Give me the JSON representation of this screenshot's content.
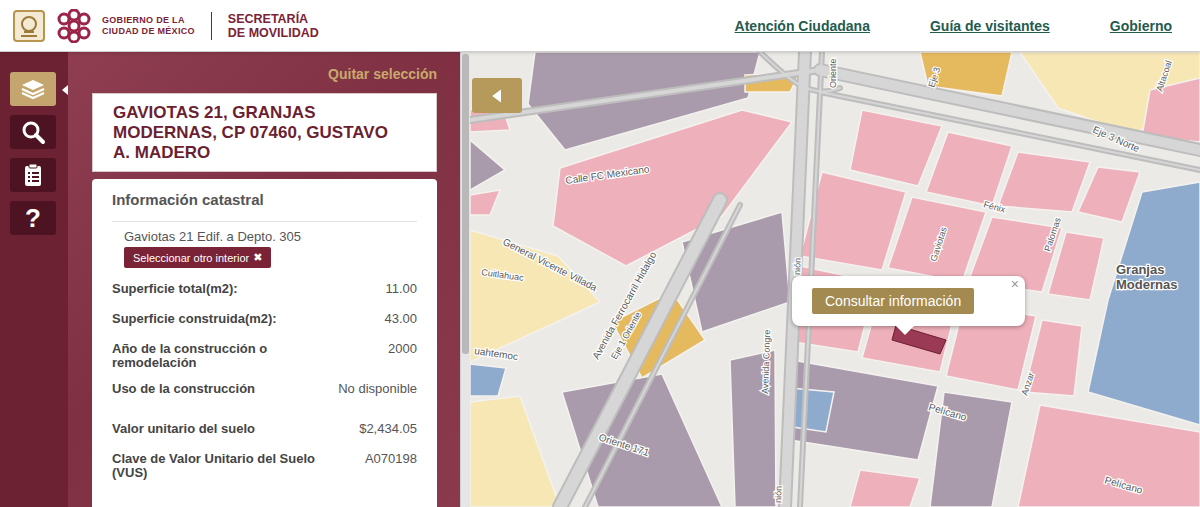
{
  "header": {
    "gob_line1": "GOBIERNO DE LA",
    "gob_line2": "CIUDAD DE MÉXICO",
    "sec_line1": "SECRETARÍA",
    "sec_line2": "DE MOVILIDAD",
    "nav": [
      "Atención Ciudadana",
      "Guía de visitantes",
      "Gobierno"
    ]
  },
  "toolbar": [
    {
      "kind": "layers",
      "selected": true
    },
    {
      "kind": "search",
      "selected": false
    },
    {
      "kind": "clipboard",
      "selected": false
    },
    {
      "kind": "help",
      "glyph": "?",
      "selected": false
    }
  ],
  "panel": {
    "clear": "Quitar selección",
    "address": "GAVIOTAS 21, GRANJAS MODERNAS, CP 07460, GUSTAVO A. MADERO",
    "section_title": "Información catastral",
    "interior": "Gaviotas 21 Edif. a Depto. 305",
    "button": "Seleccionar otro interior",
    "button_icon": "✖",
    "rows": [
      {
        "label": "Superficie total(m2):",
        "value": "11.00"
      },
      {
        "label": "Superficie construida(m2):",
        "value": "43.00"
      },
      {
        "label": "Año de la construcción o remodelación",
        "value": "2000"
      },
      {
        "label": "Uso de la construcción",
        "value": "No disponible"
      },
      {
        "label": "Valor unitario del suelo",
        "value": "$2,434.05"
      },
      {
        "label": "Clave de Valor Unitario del Suelo (VUS)",
        "value": "A070198"
      }
    ]
  },
  "map": {
    "popup": {
      "button": "Consultar información",
      "close": "×"
    },
    "labels": [
      "Oriente",
      "Eje 3",
      "Eje 3 Norte",
      "Altacoal",
      "Calle FC Mexicano",
      "General Vicente Villada",
      "Cuitlahuac",
      "uahtemoc",
      "Avenida Ferrocarril Hidalgo",
      "Eje 1 Oriente",
      "nión",
      "Avenida Congre",
      "nión",
      "Fénix",
      "Gaviotas",
      "Palomas",
      "Granjas",
      "Modernas",
      "Pelícano",
      "Pelícano",
      "Anzar",
      "Oriente 171"
    ]
  }
}
